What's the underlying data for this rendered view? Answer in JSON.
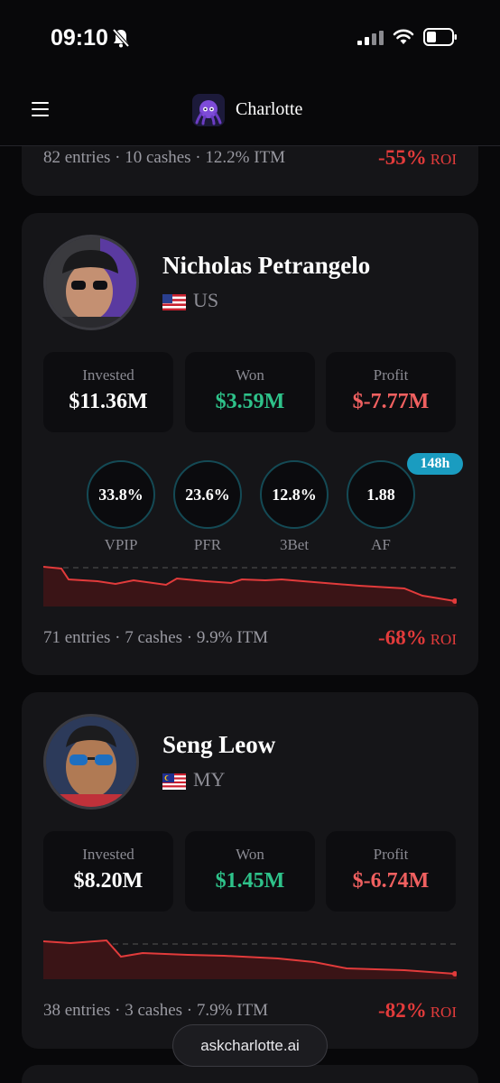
{
  "status": {
    "time": "09:10"
  },
  "nav": {
    "brand": "Charlotte"
  },
  "partial_card": {
    "summary": "82 entries · 10 cashes · 12.2% ITM",
    "roi_value": "-55%",
    "roi_label": "ROI"
  },
  "players": [
    {
      "name": "Nicholas Petrangelo",
      "country": "US",
      "stats": [
        {
          "label": "Invested",
          "value": "$11.36M"
        },
        {
          "label": "Won",
          "value": "$3.59M"
        },
        {
          "label": "Profit",
          "value": "$-7.77M"
        }
      ],
      "metrics": [
        {
          "label": "VPIP",
          "value": "33.8%"
        },
        {
          "label": "PFR",
          "value": "23.6%"
        },
        {
          "label": "3Bet",
          "value": "12.8%"
        },
        {
          "label": "AF",
          "value": "1.88"
        }
      ],
      "hours_badge": "148h",
      "summary": "71 entries · 7 cashes · 9.9% ITM",
      "roi_value": "-68%",
      "roi_label": "ROI"
    },
    {
      "name": "Seng Leow",
      "country": "MY",
      "stats": [
        {
          "label": "Invested",
          "value": "$8.20M"
        },
        {
          "label": "Won",
          "value": "$1.45M"
        },
        {
          "label": "Profit",
          "value": "$-6.74M"
        }
      ],
      "summary": "38 entries · 3 cashes · 7.9% ITM",
      "roi_value": "-82%",
      "roi_label": "ROI"
    }
  ],
  "footer": {
    "site": "askcharlotte.ai"
  },
  "colors": {
    "accent_red": "#e23b3b",
    "won_green": "#2ec28a",
    "badge_blue": "#1a9cc0"
  },
  "icons": [
    "bell-slash-icon",
    "signal-icon",
    "wifi-icon",
    "battery-icon",
    "menu-icon",
    "charlotte-logo-icon",
    "us-flag-icon",
    "my-flag-icon"
  ]
}
